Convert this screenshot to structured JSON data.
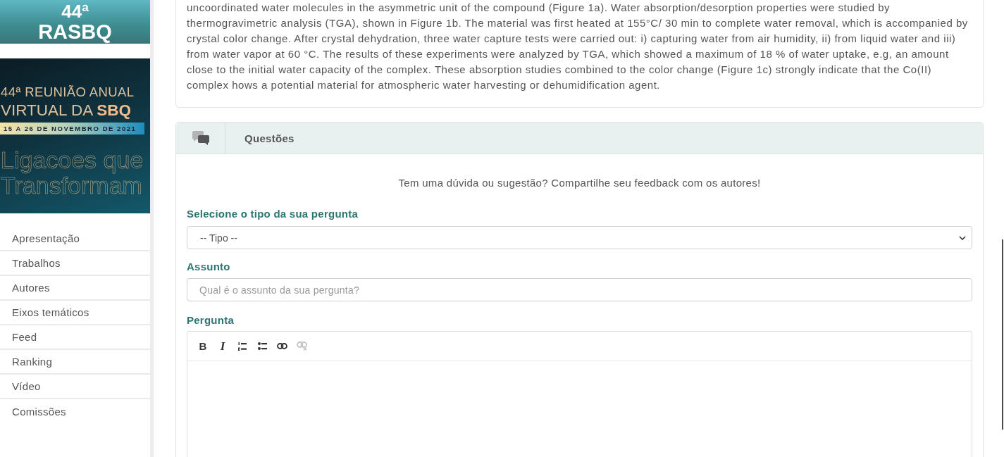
{
  "sidebar": {
    "banner": {
      "number": "44ª",
      "acronym": "RASBQ"
    },
    "poster": {
      "title_lines": [
        "44ª REUNIÃO ANUAL",
        "VIRTUAL DA **SBQ**"
      ],
      "dates": "15 A 26 DE NOVEMBRO DE 2021",
      "slogan": "Ligacoes que Transformam"
    },
    "menu": [
      {
        "label": "Apresentação"
      },
      {
        "label": "Trabalhos"
      },
      {
        "label": "Autores"
      },
      {
        "label": "Eixos temáticos"
      },
      {
        "label": "Feed"
      },
      {
        "label": "Ranking"
      },
      {
        "label": "Vídeo"
      },
      {
        "label": "Comissões"
      }
    ]
  },
  "abstract": {
    "text": "uncoordinated water molecules in the asymmetric unit of the compound (Figure 1a). Water absorption/desorption properties were studied by thermogravimetric analysis (TGA), shown in Figure 1b. The material was first heated at 155°C/ 30 min to complete water removal, which is accompanied by crystal color change. After crystal dehydration, three water capture tests were carried out: i) capturing water from air humidity, ii) from liquid water and iii) from water vapor at 60 °C. The results of these experiments were analyzed by TGA, which showed a maximum of 18 % of water uptake, e.g, an amount close to the initial water capacity of the complex. These absorption studies combined to the color change (Figure 1c) strongly indicate that the Co(II) complex hows a potential material for atmospheric water harvesting or dehumidification agent."
  },
  "questions": {
    "title": "Questões",
    "intro": "Tem uma dúvida ou sugestão? Compartilhe seu feedback com os autores!",
    "type_field": {
      "label": "Selecione o tipo da sua pergunta",
      "value": "-- Tipo --"
    },
    "subject_field": {
      "label": "Assunto",
      "placeholder": "Qual é o assunto da sua pergunta?"
    },
    "question_field": {
      "label": "Pergunta",
      "toolbar": [
        {
          "kind": "bold",
          "glyph": "B",
          "disabled": false
        },
        {
          "kind": "italic",
          "glyph": "I",
          "disabled": false
        },
        {
          "kind": "ordered-list",
          "disabled": false
        },
        {
          "kind": "bullet-list",
          "disabled": false
        },
        {
          "kind": "link",
          "disabled": false
        },
        {
          "kind": "unlink",
          "disabled": true
        }
      ]
    }
  }
}
